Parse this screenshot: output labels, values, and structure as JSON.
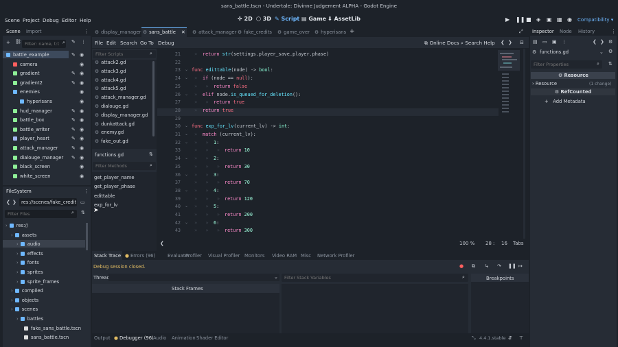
{
  "window_title": "sans_battle.tscn - Undertale: Divinne Judgement ALPHA - Godot Engine",
  "menu": [
    "Scene",
    "Project",
    "Debug",
    "Editor",
    "Help"
  ],
  "workspaces": [
    "2D",
    "3D",
    "Script",
    "Game",
    "AssetLib"
  ],
  "renderer": "Compatibility",
  "scene_dock": {
    "tabs": [
      "Scene",
      "Import"
    ],
    "filter_placeholder": "Filter: name, t:t",
    "nodes": [
      {
        "name": "battle_example",
        "color": "#6fb8ff"
      },
      {
        "name": "camera",
        "color": "#ff5f5f"
      },
      {
        "name": "gradient",
        "color": "#8eef97"
      },
      {
        "name": "gradient2",
        "color": "#8eef97"
      },
      {
        "name": "enemies",
        "color": "#6fb8ff"
      },
      {
        "name": "hyperisans",
        "color": "#6fb8ff"
      },
      {
        "name": "hud_manager",
        "color": "#8eef97"
      },
      {
        "name": "battle_box",
        "color": "#8eef97"
      },
      {
        "name": "battle_writer",
        "color": "#8eef97"
      },
      {
        "name": "player_heart",
        "color": "#a5b7f3"
      },
      {
        "name": "attack_manager",
        "color": "#8eef97"
      },
      {
        "name": "dialouge_manager",
        "color": "#8eef97"
      },
      {
        "name": "black_screen",
        "color": "#8eef97"
      },
      {
        "name": "white_screen",
        "color": "#8eef97"
      }
    ]
  },
  "filesystem": {
    "title": "FileSystem",
    "path": "res://scenes/fake_credits.t",
    "filter_placeholder": "Filter Files",
    "items": [
      "res://",
      "assets",
      "audio",
      "effects",
      "fonts",
      "sprites",
      "sprite_frames",
      "compiled",
      "objects",
      "scenes",
      "battles",
      "fake_sans_battle.tscn",
      "sans_battle.tscn"
    ]
  },
  "script_tabs": [
    "display_manager",
    "sans_battle",
    "attack_manager",
    "fake_credits",
    "game_over",
    "hyperisans"
  ],
  "script_menu": [
    "File",
    "Edit",
    "Search",
    "Go To",
    "Debug"
  ],
  "online_docs": "Online Docs",
  "search_help": "Search Help",
  "filter_scripts": "Filter Scripts",
  "scripts": [
    "attack2.gd",
    "attack3.gd",
    "attack4.gd",
    "attack5.gd",
    "attack_manager.gd",
    "dialouge.gd",
    "display_manager.gd",
    "dunkattack.gd",
    "enemy.gd",
    "fake_out.gd"
  ],
  "current_script": "functions.gd",
  "filter_methods": "Filter Methods",
  "methods": [
    "get_player_name",
    "get_player_phase",
    "edittable",
    "exp_for_lv"
  ],
  "code_lines": [
    {
      "n": "21",
      "t": "return str(settings.player_save.player.phase)"
    },
    {
      "n": "22",
      "t": ""
    },
    {
      "n": "23",
      "t": "func edittable(node) -> bool:"
    },
    {
      "n": "24",
      "t": "if (node == null):"
    },
    {
      "n": "25",
      "t": "return false"
    },
    {
      "n": "26",
      "t": "elif node.is_queued_for_deletion():"
    },
    {
      "n": "27",
      "t": "return true"
    },
    {
      "n": "28",
      "t": "return true"
    },
    {
      "n": "29",
      "t": ""
    },
    {
      "n": "30",
      "t": "func exp_for_lv(current_lv) -> int:"
    },
    {
      "n": "31",
      "t": "match (current_lv):"
    },
    {
      "n": "32",
      "t": "1:"
    },
    {
      "n": "33",
      "t": "return 10"
    },
    {
      "n": "34",
      "t": "2:"
    },
    {
      "n": "35",
      "t": "return 30"
    },
    {
      "n": "36",
      "t": "3:"
    },
    {
      "n": "37",
      "t": "return 70"
    },
    {
      "n": "38",
      "t": "4:"
    },
    {
      "n": "39",
      "t": "return 120"
    },
    {
      "n": "40",
      "t": "5:"
    },
    {
      "n": "41",
      "t": "return 200"
    },
    {
      "n": "42",
      "t": "6:"
    },
    {
      "n": "43",
      "t": "return 300"
    }
  ],
  "status": {
    "zoom": "100 %",
    "line": "28",
    "col": "16",
    "indent": "Tabs"
  },
  "debugger": {
    "tabs": [
      "Stack Trace",
      "Errors (96)",
      "Evaluator",
      "Profiler",
      "Visual Profiler",
      "Monitors",
      "Video RAM",
      "Misc",
      "Network Profiler"
    ],
    "message": "Debug session closed.",
    "thread_label": "Thread:",
    "stack_frames": "Stack Frames",
    "filter_vars": "Filter Stack Variables",
    "breakpoints": "Breakpoints"
  },
  "bottom_tabs": [
    "Output",
    "Debugger (96)",
    "Audio",
    "Animation",
    "Shader Editor"
  ],
  "version": "4.4.1.stable",
  "inspector": {
    "tabs": [
      "Inspector",
      "Node",
      "History"
    ],
    "object": "functions.gd",
    "filter_placeholder": "Filter Properties",
    "resource_header": "Resource",
    "resource_row": "Resource",
    "change": "(1 change)",
    "refcounted": "RefCounted",
    "add_metadata": "Add Metadata"
  }
}
